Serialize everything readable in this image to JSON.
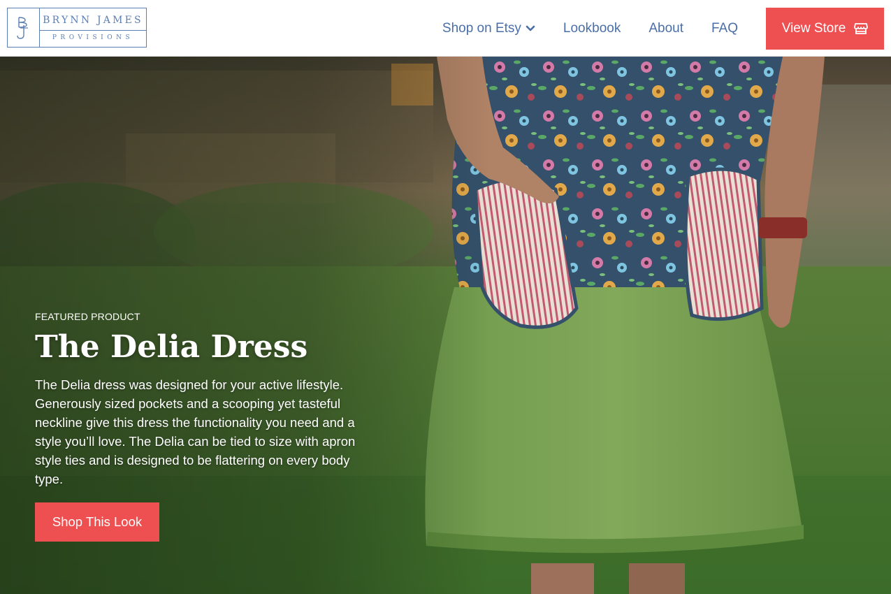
{
  "brand": {
    "name": "BRYNN JAMES",
    "sub": "PROVISIONS",
    "monogram": "BJ"
  },
  "nav": {
    "shop_etsy": "Shop on Etsy",
    "lookbook": "Lookbook",
    "about": "About",
    "faq": "FAQ",
    "view_store": "View Store"
  },
  "hero": {
    "eyebrow": "FEATURED PRODUCT",
    "title": "The Delia Dress",
    "description": "The Delia dress was designed for your active lifestyle. Generously sized pockets and a scooping yet tasteful neckline give this dress the functionality you need and a style you’ll love. The Delia can be tied to size with apron style ties and is designed to be flattering on every body type.",
    "cta": "Shop This Look"
  },
  "icons": {
    "chevron": "chevron-down-icon",
    "store": "store-icon"
  },
  "colors": {
    "brand_blue": "#5b7fb5",
    "nav_blue": "#4a6fa8",
    "accent_red": "#ee4f50"
  }
}
